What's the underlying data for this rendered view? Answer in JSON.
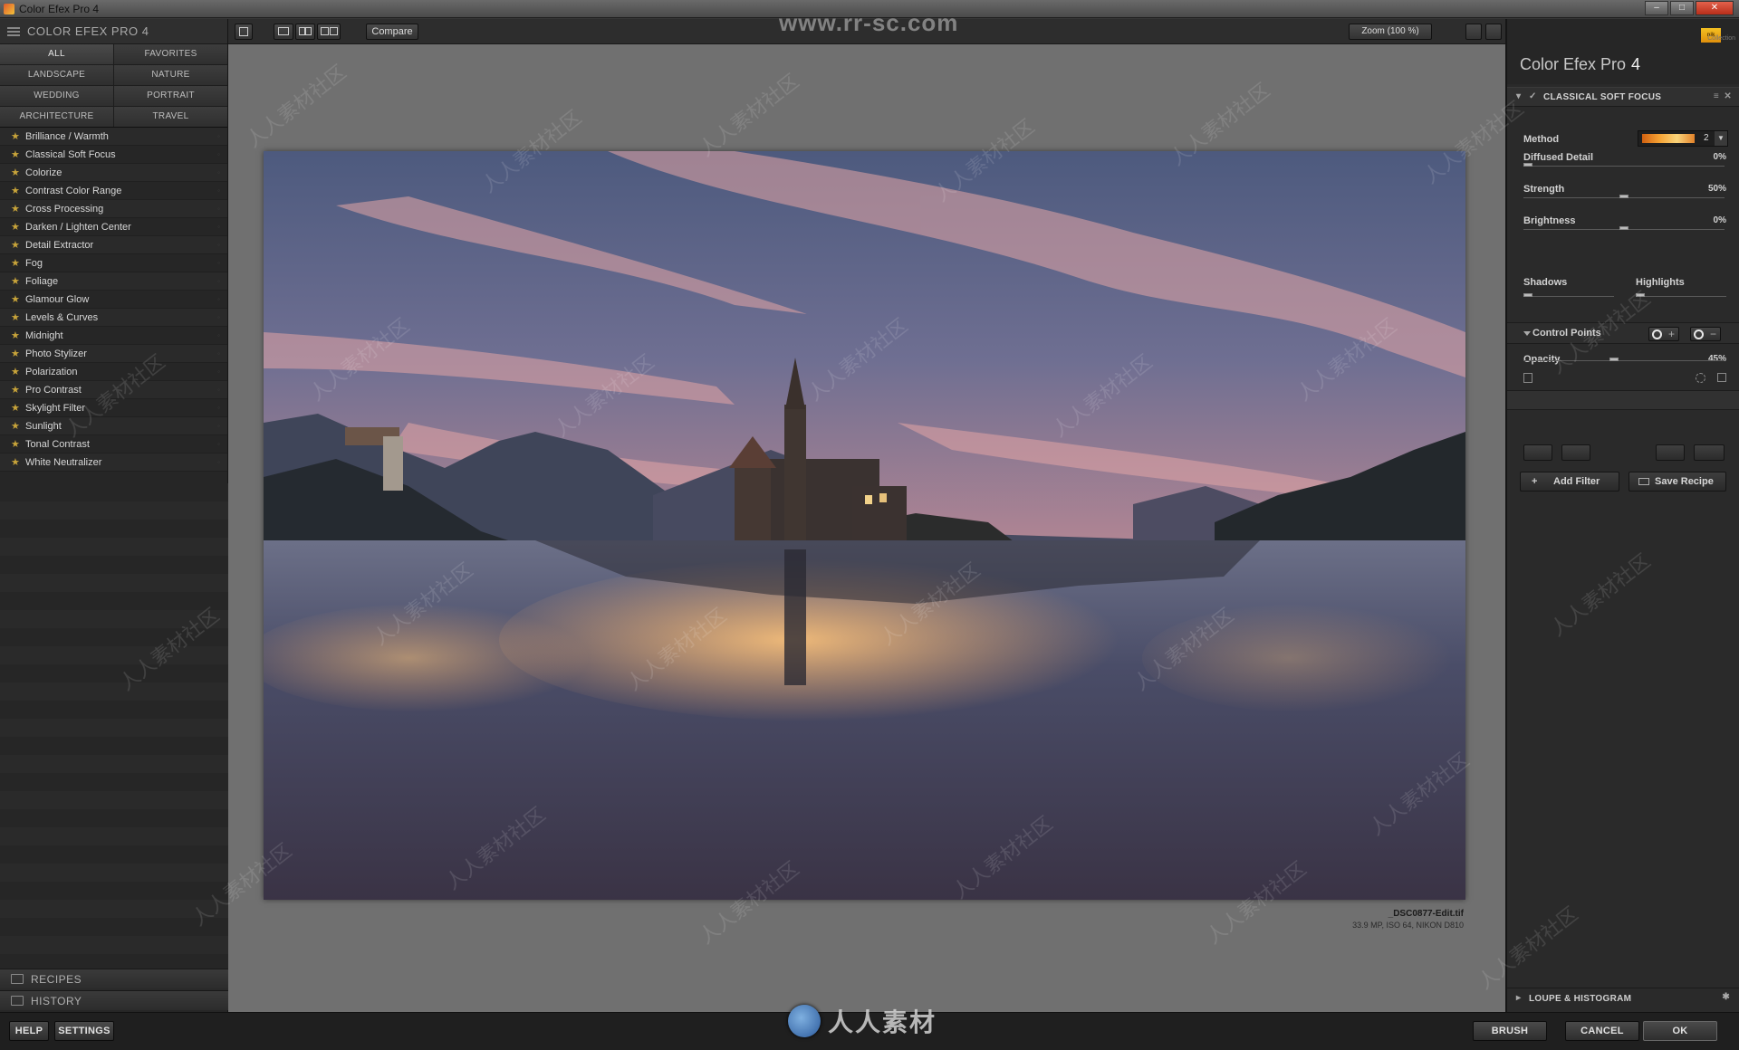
{
  "window": {
    "title": "Color Efex Pro 4",
    "minimize": "–",
    "maximize": "□",
    "close": "✕"
  },
  "watermark": {
    "site": "www.rr-sc.com",
    "text": "人人素材社区",
    "logo_text": "人人素材"
  },
  "left_panel": {
    "brand": "COLOR EFEX PRO 4",
    "categories": [
      "ALL",
      "FAVORITES",
      "LANDSCAPE",
      "NATURE",
      "WEDDING",
      "PORTRAIT",
      "ARCHITECTURE",
      "TRAVEL"
    ],
    "filters": [
      "Brilliance / Warmth",
      "Classical Soft Focus",
      "Colorize",
      "Contrast Color Range",
      "Cross Processing",
      "Darken / Lighten Center",
      "Detail Extractor",
      "Fog",
      "Foliage",
      "Glamour Glow",
      "Levels & Curves",
      "Midnight",
      "Photo Stylizer",
      "Polarization",
      "Pro Contrast",
      "Skylight Filter",
      "Sunlight",
      "Tonal Contrast",
      "White Neutralizer"
    ],
    "recipes": "RECIPES",
    "history": "HISTORY"
  },
  "toolbar": {
    "compare": "Compare",
    "zoom": "Zoom (100 %)"
  },
  "image": {
    "filename": "_DSC0877-Edit.tif",
    "meta": "33.9 MP, ISO 64, NIKON D810"
  },
  "right_panel": {
    "collection": "Collection",
    "nik_badge": "nik",
    "product": "Color Efex Pro",
    "version": "4",
    "filter_name": "CLASSICAL SOFT FOCUS",
    "method_label": "Method",
    "method_value": "2",
    "sliders": [
      {
        "label": "Diffused Detail",
        "value": "0%",
        "level": 0.0
      },
      {
        "label": "Strength",
        "value": "50%",
        "level": 0.5
      },
      {
        "label": "Brightness",
        "value": "0%",
        "level": 0.5
      }
    ],
    "shadows_label": "Shadows",
    "highlights_label": "Highlights",
    "control_points": "Control Points",
    "opacity": {
      "label": "Opacity",
      "value": "45%",
      "level": 0.45
    },
    "add_filter": "Add Filter",
    "save_recipe": "Save Recipe",
    "loupe": "LOUPE & HISTOGRAM"
  },
  "bottom": {
    "help": "HELP",
    "settings": "SETTINGS",
    "brush": "BRUSH",
    "cancel": "CANCEL",
    "ok": "OK"
  }
}
